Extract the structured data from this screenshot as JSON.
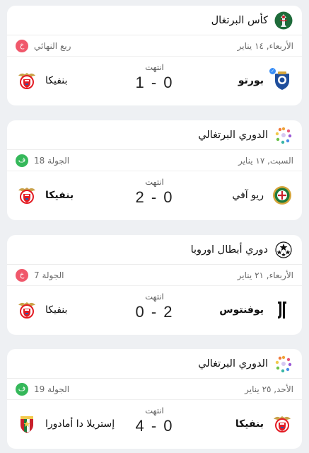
{
  "colors": {
    "badge_red": "#f0586b",
    "badge_green": "#35b85a",
    "porto_blue": "#1f4e9c",
    "benfica_red": "#e31b23",
    "rio_ave_green": "#1e7a3a"
  },
  "cards": [
    {
      "competition": "كأس البرتغال",
      "competition_icon": "portugal-cup-icon",
      "date": "الأربعاء, ١٤ يناير",
      "round": "ربع النهائي",
      "badge": "خ",
      "status": "انتهت",
      "score": "1 - 0",
      "home": "بورتو",
      "away": "بنفيكا"
    },
    {
      "competition": "الدوري البرتغالي",
      "competition_icon": "liga-portugal-icon",
      "date": "السبت, ١٧ يناير",
      "round": "الجولة 18",
      "badge": "ف",
      "status": "انتهت",
      "score": "2 - 0",
      "home": "ريو آفي",
      "away": "بنفيكا"
    },
    {
      "competition": "دوري أبطال اوروبا",
      "competition_icon": "champions-league-icon",
      "date": "الأربعاء, ٢١ يناير",
      "round": "الجولة 7",
      "badge": "خ",
      "status": "انتهت",
      "score": "0 - 2",
      "home": "يوفنتوس",
      "away": "بنفيكا"
    },
    {
      "competition": "الدوري البرتغالي",
      "competition_icon": "liga-portugal-icon",
      "date": "الأحد, ٢٥ يناير",
      "round": "الجولة 19",
      "badge": "ف",
      "status": "انتهت",
      "score": "4 - 0",
      "home": "بنفيكا",
      "away": "إستريلا دا أمادورا"
    }
  ]
}
